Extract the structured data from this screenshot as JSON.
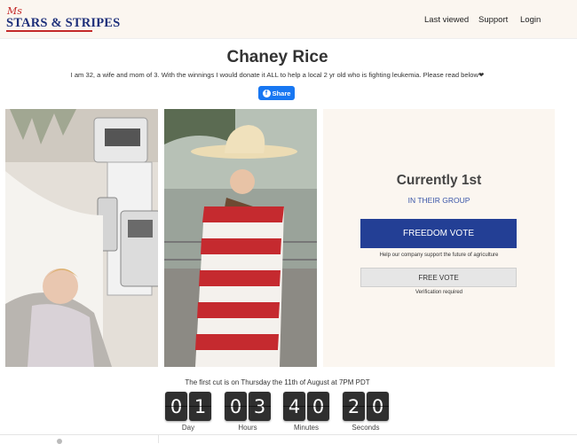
{
  "header": {
    "logo_ms": "Ms",
    "logo_main": "STARS & STRIPES",
    "nav": [
      "Last viewed",
      "Support",
      "Login"
    ]
  },
  "contestant": {
    "name": "Chaney Rice",
    "bio": "I am 32, a wife and mom of 3. With the winnings I would donate it ALL to help a local 2 yr old who is fighting leukemia. Please read below❤",
    "share_label": "Share",
    "share_icon": "facebook-icon"
  },
  "panel": {
    "rank": "Currently 1st",
    "group_prefix": "IN ",
    "group_link": "THEIR GROUP",
    "freedom_vote": "FREEDOM VOTE",
    "freedom_note": "Help our company support the future of agriculture",
    "free_vote": "FREE VOTE",
    "verification": "Verification required"
  },
  "countdown": {
    "message": "The first cut is on Thursday the 11th of August at 7PM PDT",
    "digits": [
      "0",
      "1",
      "0",
      "3",
      "4",
      "0",
      "2",
      "0"
    ],
    "labels": [
      "Day",
      "Hours",
      "Minutes",
      "Seconds"
    ]
  },
  "colors": {
    "accent_blue": "#233f95",
    "brand_red": "#c42a2a",
    "panel_bg": "#fbf6f0"
  }
}
